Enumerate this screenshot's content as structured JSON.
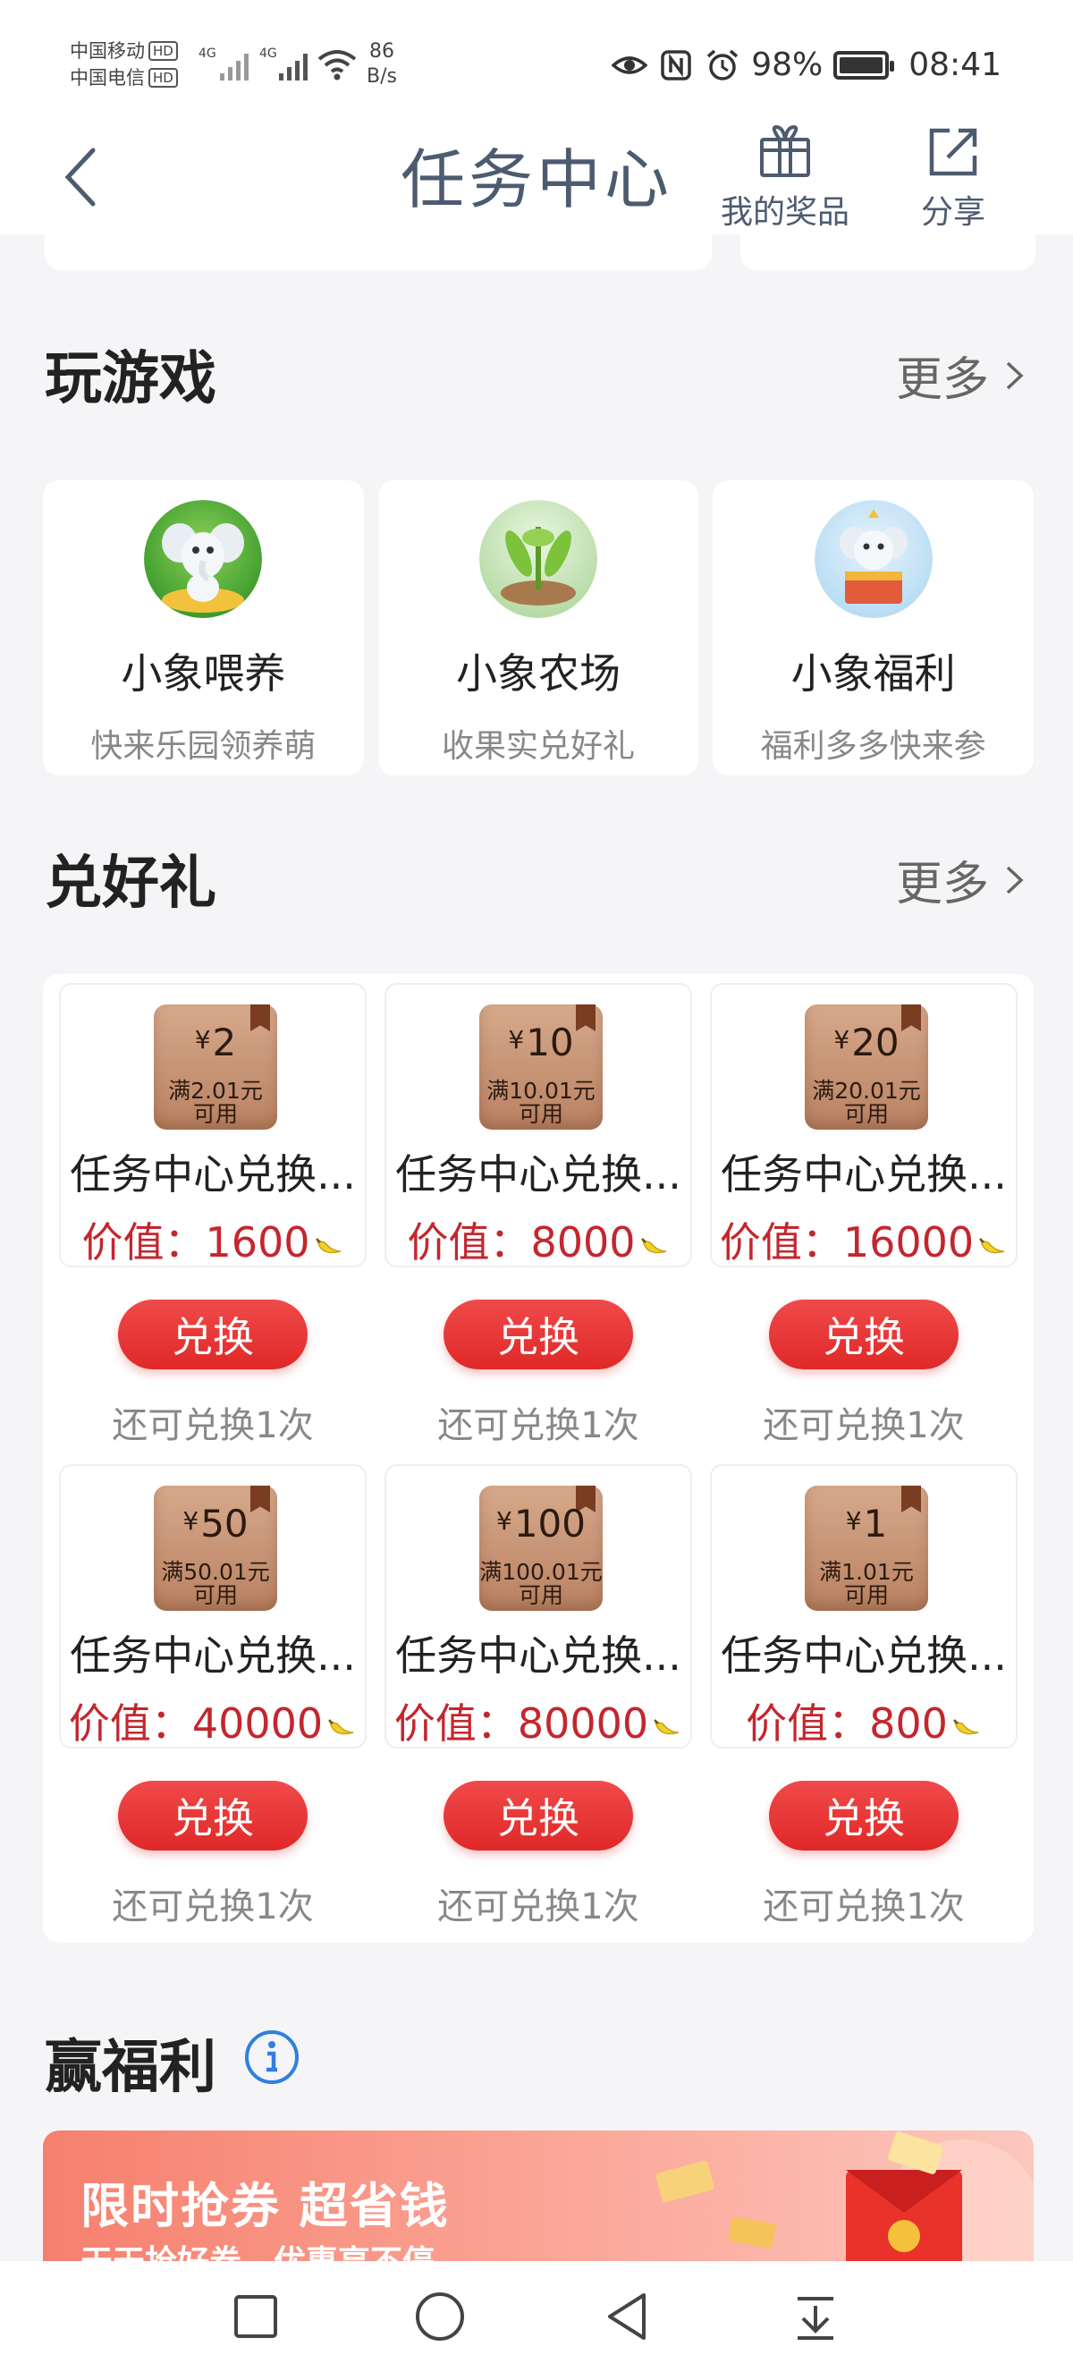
{
  "status_bar": {
    "carrier1": "中国移动",
    "carrier2": "中国电信",
    "hd": "HD",
    "net1": "4G",
    "net2": "4G",
    "speed_value": "86",
    "speed_unit": "B/s",
    "battery": "98%",
    "time": "08:41"
  },
  "nav": {
    "title": "任务中心",
    "prizes_label": "我的奖品",
    "share_label": "分享"
  },
  "games_section": {
    "title": "玩游戏",
    "more": "更多",
    "items": [
      {
        "name": "小象喂养",
        "desc": "快来乐园领养萌"
      },
      {
        "name": "小象农场",
        "desc": "收果实兑好礼"
      },
      {
        "name": "小象福利",
        "desc": "福利多多快来参"
      }
    ]
  },
  "rewards_section": {
    "title": "兑好礼",
    "more": "更多",
    "currency_symbol": "¥",
    "items": [
      {
        "amount": "2",
        "condition": "满2.01元",
        "usable": "可用",
        "name": "任务中心兑换...",
        "value": "价值：1600",
        "button": "兑换",
        "remain": "还可兑换1次"
      },
      {
        "amount": "10",
        "condition": "满10.01元",
        "usable": "可用",
        "name": "任务中心兑换...",
        "value": "价值：8000",
        "button": "兑换",
        "remain": "还可兑换1次"
      },
      {
        "amount": "20",
        "condition": "满20.01元",
        "usable": "可用",
        "name": "任务中心兑换...",
        "value": "价值：16000",
        "button": "兑换",
        "remain": "还可兑换1次"
      },
      {
        "amount": "50",
        "condition": "满50.01元",
        "usable": "可用",
        "name": "任务中心兑换...",
        "value": "价值：40000",
        "button": "兑换",
        "remain": "还可兑换1次"
      },
      {
        "amount": "100",
        "condition": "满100.01元",
        "usable": "可用",
        "name": "任务中心兑换...",
        "value": "价值：80000",
        "button": "兑换",
        "remain": "还可兑换1次"
      },
      {
        "amount": "1",
        "condition": "满1.01元",
        "usable": "可用",
        "name": "任务中心兑换...",
        "value": "价值：800",
        "button": "兑换",
        "remain": "还可兑换1次"
      }
    ]
  },
  "welfare_section": {
    "title": "赢福利",
    "promo_title": "限时抢券 超省钱",
    "promo_subtitle": "天天抢好券，优惠享不停"
  },
  "icons": {
    "back": "chevron-left-icon",
    "prizes": "gift-icon",
    "share": "share-icon",
    "more": "chevron-right-icon",
    "info": "info-icon",
    "banana": "banana-icon"
  },
  "colors": {
    "accent_red": "#e02828",
    "value_red": "#c4262e",
    "nav_text": "#4d5b70",
    "page_bg": "#f5f5f7",
    "info_blue": "#2f7fe0"
  }
}
